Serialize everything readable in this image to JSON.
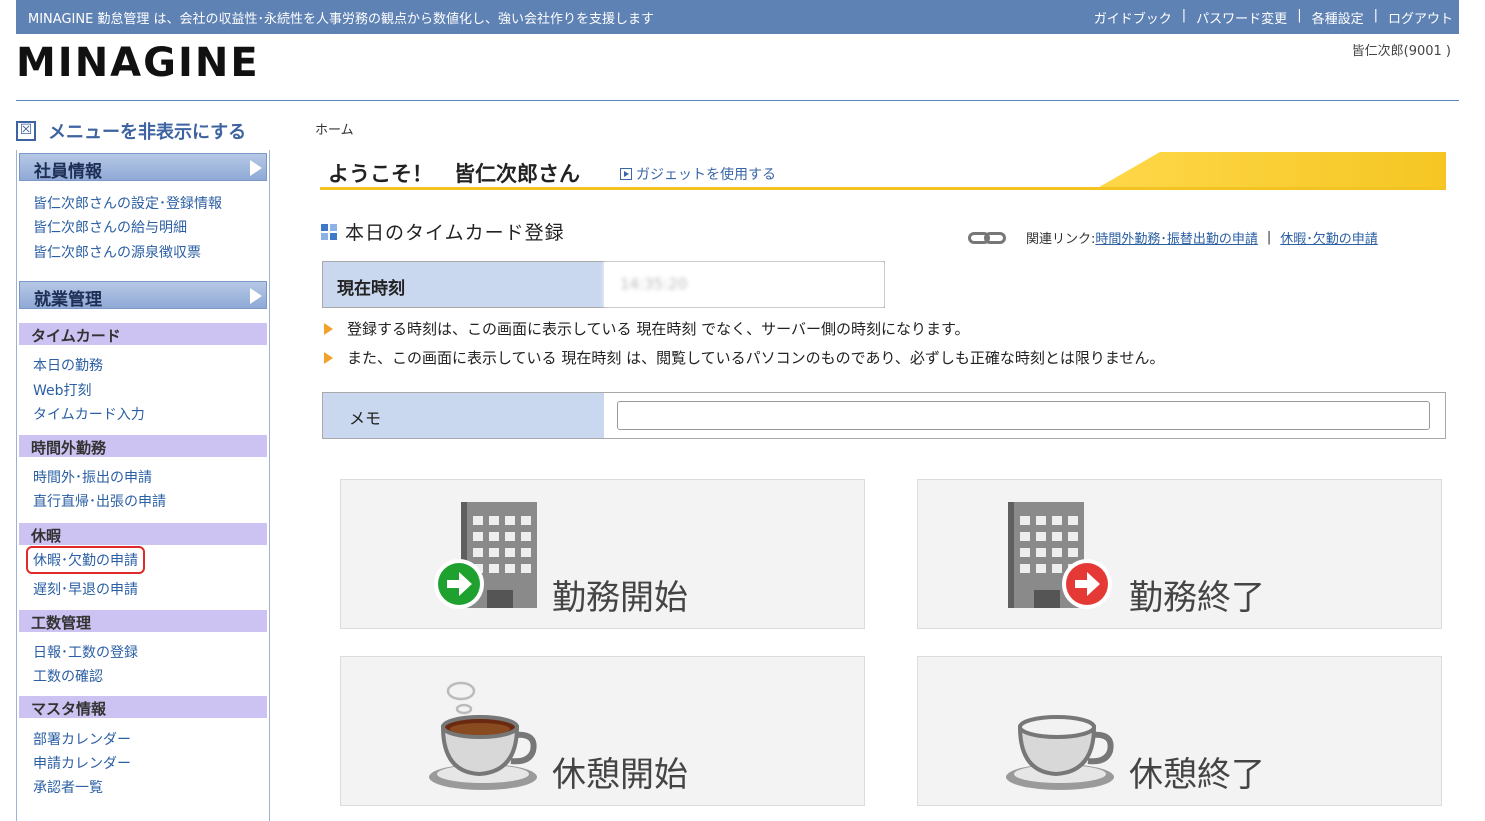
{
  "header": {
    "tagline": "MINAGINE 勤怠管理 は、会社の収益性･永続性を人事労務の観点から数値化し、強い会社作りを支援します",
    "links": [
      "ガイドブック",
      "パスワード変更",
      "各種設定",
      "ログアウト"
    ],
    "separator": "|",
    "logo": "MINAGINE",
    "user": "皆仁次郎(9001 )"
  },
  "sidebar": {
    "toggle_icon": "☒",
    "toggle_label": "メニューを非表示にする",
    "employee_info": {
      "title": "社員情報",
      "items": [
        "皆仁次郎さんの設定･登録情報",
        "皆仁次郎さんの給与明細",
        "皆仁次郎さんの源泉徴収票"
      ]
    },
    "work_management": {
      "title": "就業管理"
    },
    "timecard": {
      "title": "タイムカード",
      "items": [
        "本日の勤務",
        "Web打刻",
        "タイムカード入力"
      ]
    },
    "overtime": {
      "title": "時間外勤務",
      "items": [
        "時間外･振出の申請",
        "直行直帰･出張の申請"
      ]
    },
    "leave": {
      "title": "休暇",
      "items": [
        "休暇･欠勤の申請",
        "遅刻･早退の申請"
      ]
    },
    "manhours": {
      "title": "工数管理",
      "items": [
        "日報･工数の登録",
        "工数の確認"
      ]
    },
    "master": {
      "title": "マスタ情報",
      "items": [
        "部署カレンダー",
        "申請カレンダー",
        "承認者一覧"
      ]
    }
  },
  "main": {
    "breadcrumb": "ホーム",
    "welcome": "ようこそ！　皆仁次郎さん",
    "gadget_link": "ガジェットを使用する",
    "section_title": "本日のタイムカード登録",
    "related_label": "関連リンク:",
    "related_links": [
      "時間外勤務･振替出勤の申請",
      "休暇･欠勤の申請"
    ],
    "related_sep": "|",
    "clock_label": "現在時刻",
    "clock_value": "14:35:20",
    "notes": [
      "登録する時刻は、この画面に表示している 現在時刻 でなく、サーバー側の時刻になります。",
      "また、この画面に表示している 現在時刻 は、閲覧しているパソコンのものであり、必ずしも正確な時刻とは限りません。"
    ],
    "memo_label": "メモ",
    "memo_value": "",
    "buttons": {
      "start_work": "勤務開始",
      "end_work": "勤務終了",
      "start_break": "休憩開始",
      "end_break": "休憩終了"
    }
  },
  "colors": {
    "topbar": "#5f82b5",
    "accent_yellow": "#f3c322",
    "start_green": "#1fa12f",
    "end_red": "#e53935"
  }
}
